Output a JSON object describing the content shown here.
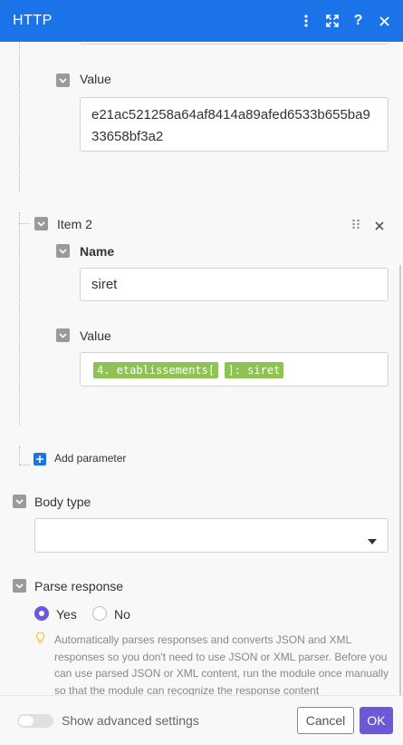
{
  "header": {
    "title": "HTTP",
    "actions": [
      {
        "icon": "more-vertical-icon"
      },
      {
        "icon": "expand-icon"
      },
      {
        "icon": "help-icon"
      },
      {
        "icon": "close-icon"
      }
    ]
  },
  "item1": {
    "value_label": "Value",
    "value": "e21ac521258a64af8414a89afed6533b655ba933658bf3a2"
  },
  "item2": {
    "title": "Item 2",
    "name_label": "Name",
    "name_value": "siret",
    "value_label": "Value",
    "value_token_1": "4. etablissements[",
    "value_token_2": "]: siret"
  },
  "add_parameter": "Add parameter",
  "body_type": {
    "label": "Body type",
    "selected": ""
  },
  "parse_response": {
    "label": "Parse response",
    "options": [
      "Yes",
      "No"
    ],
    "selected": "Yes",
    "hint": "Automatically parses responses and converts JSON and XML responses so you don't need to use JSON or XML parser. Before you can use parsed JSON or XML content, run the module once manually so that the module can recognize the response content"
  },
  "footer": {
    "advanced_label": "Show advanced settings",
    "cancel_label": "Cancel",
    "ok_label": "OK"
  },
  "colors": {
    "header": "#1a73e8",
    "accent": "#6a5ad8",
    "pill": "#8fc255"
  }
}
